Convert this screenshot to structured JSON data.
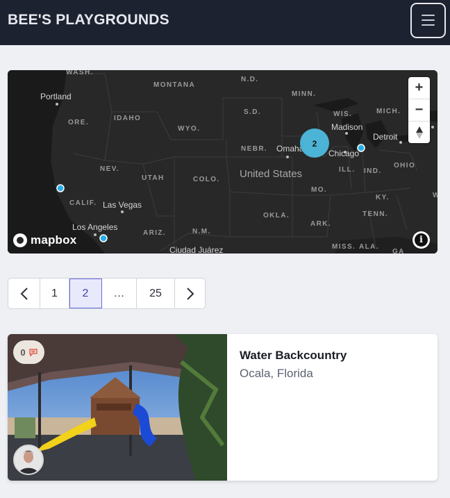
{
  "navbar": {
    "brand": "BEE'S PLAYGROUNDS",
    "menu_icon": "hamburger-icon"
  },
  "map": {
    "labels": {
      "wash": "WASH.",
      "montana": "MONTANA",
      "nd": "N.D.",
      "minn": "MINN.",
      "portland": "Portland",
      "ore": "ORE.",
      "idaho": "IDAHO",
      "wyo": "WYO.",
      "sd": "S.D.",
      "wis": "WIS.",
      "mich": "MICH.",
      "madison": "Madison",
      "detroit": "Detroit",
      "nebr": "NEBR.",
      "omaha": "Omaha",
      "chicago": "Chicago",
      "nev": "NEV.",
      "utah": "UTAH",
      "colo": "COLO.",
      "united_states": "United States",
      "ill": "ILL.",
      "ind": "IND.",
      "ohio": "OHIO",
      "calif": "CALIF.",
      "las_vegas": "Las Vegas",
      "mo": "MO.",
      "ky": "KY.",
      "w": "W",
      "okla": "OKLA.",
      "tenn": "TENN.",
      "los_angeles": "Los Angeles",
      "ariz": "ARIZ.",
      "nm": "N.M.",
      "ark": "ARK.",
      "ciudad_juarez": "Ciudad Juárez",
      "miss": "MISS.",
      "ala": "ALA.",
      "ga": "GA"
    },
    "cluster_count": "2",
    "attribution_logo": "mapbox",
    "controls": {
      "zoom_in": "+",
      "zoom_out": "−",
      "compass_icon": "compass-icon",
      "info": "i"
    }
  },
  "pagination": {
    "prev_icon": "chevron-left-icon",
    "pages": [
      "1",
      "2",
      "…",
      "25"
    ],
    "active": "2",
    "next_icon": "chevron-right-icon"
  },
  "card": {
    "title": "Water Backcountry",
    "subtitle": "Ocala, Florida",
    "comment_count": "0",
    "comment_icon": "comment-icon"
  },
  "colors": {
    "navbar": "#1d2230",
    "accent": "#3d3fb0",
    "marker": "#29aee6",
    "cluster": "#4bb3d6"
  }
}
